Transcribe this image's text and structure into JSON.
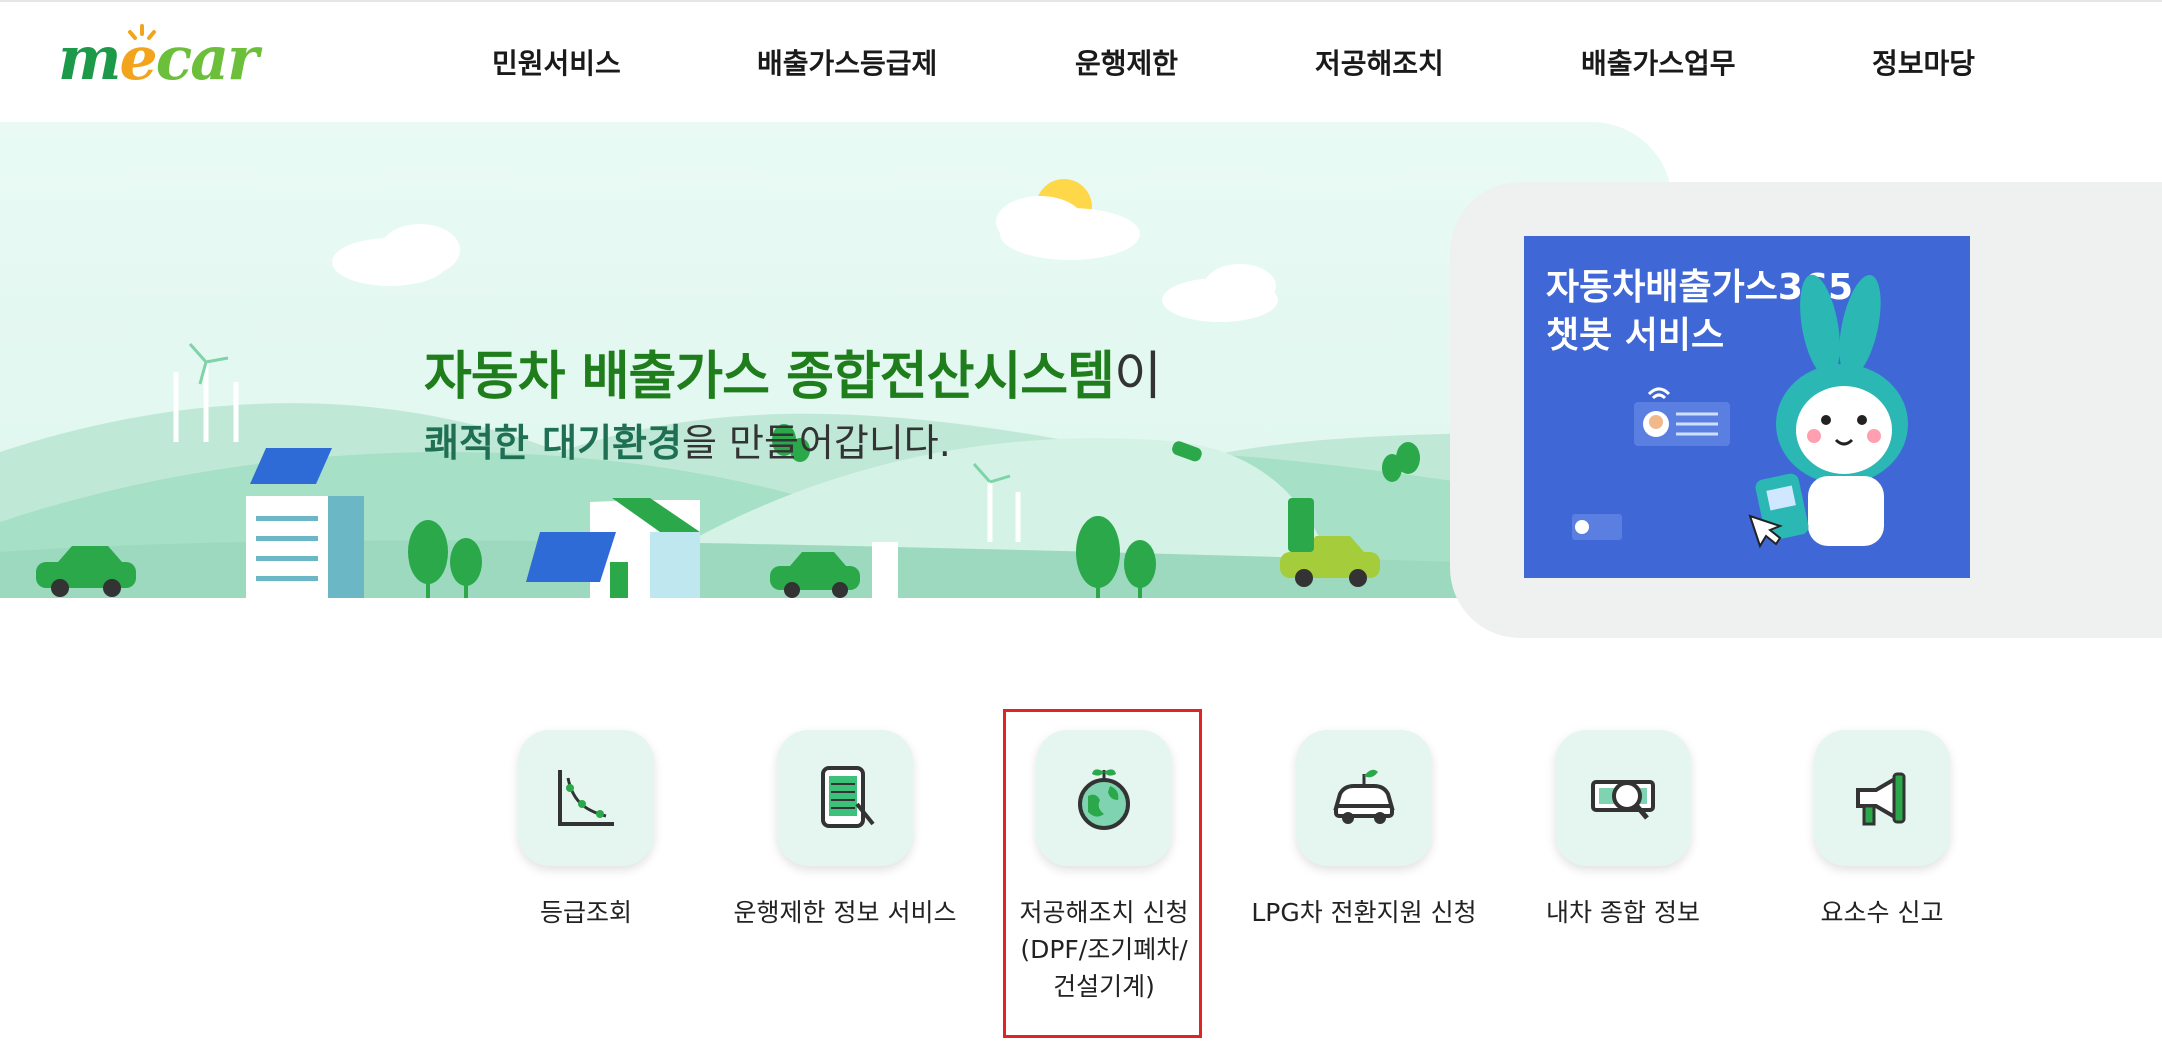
{
  "header": {
    "logo": "mecar",
    "nav": [
      "민원서비스",
      "배출가스등급제",
      "운행제한",
      "저공해조치",
      "배출가스업무",
      "정보마당"
    ]
  },
  "hero": {
    "headline_main": "자동차 배출가스 종합전산시스템",
    "headline_suffix": "이",
    "subline_highlight": "쾌적한 대기환경",
    "subline_rest": "을 만들어갑니다."
  },
  "promo": {
    "title": "자동차배출가스365\n챗봇 서비스"
  },
  "services": [
    {
      "label": "등급조회",
      "icon": "grade-chart-icon"
    },
    {
      "label": "운행제한 정보 서비스",
      "icon": "tablet-list-icon"
    },
    {
      "label": "저공해조치 신청\n(DPF/조기폐차/\n건설기계)",
      "icon": "earth-sprout-icon"
    },
    {
      "label": "LPG차 전환지원 신청",
      "icon": "eco-car-icon"
    },
    {
      "label": "내차 종합 정보",
      "icon": "money-search-icon"
    },
    {
      "label": "요소수 신고",
      "icon": "megaphone-icon"
    }
  ],
  "colors": {
    "brand_green": "#1f7d1c",
    "tile_bg": "#e4f6ef",
    "promo_blue": "#3f67d6",
    "highlight_red": "#e02424"
  }
}
